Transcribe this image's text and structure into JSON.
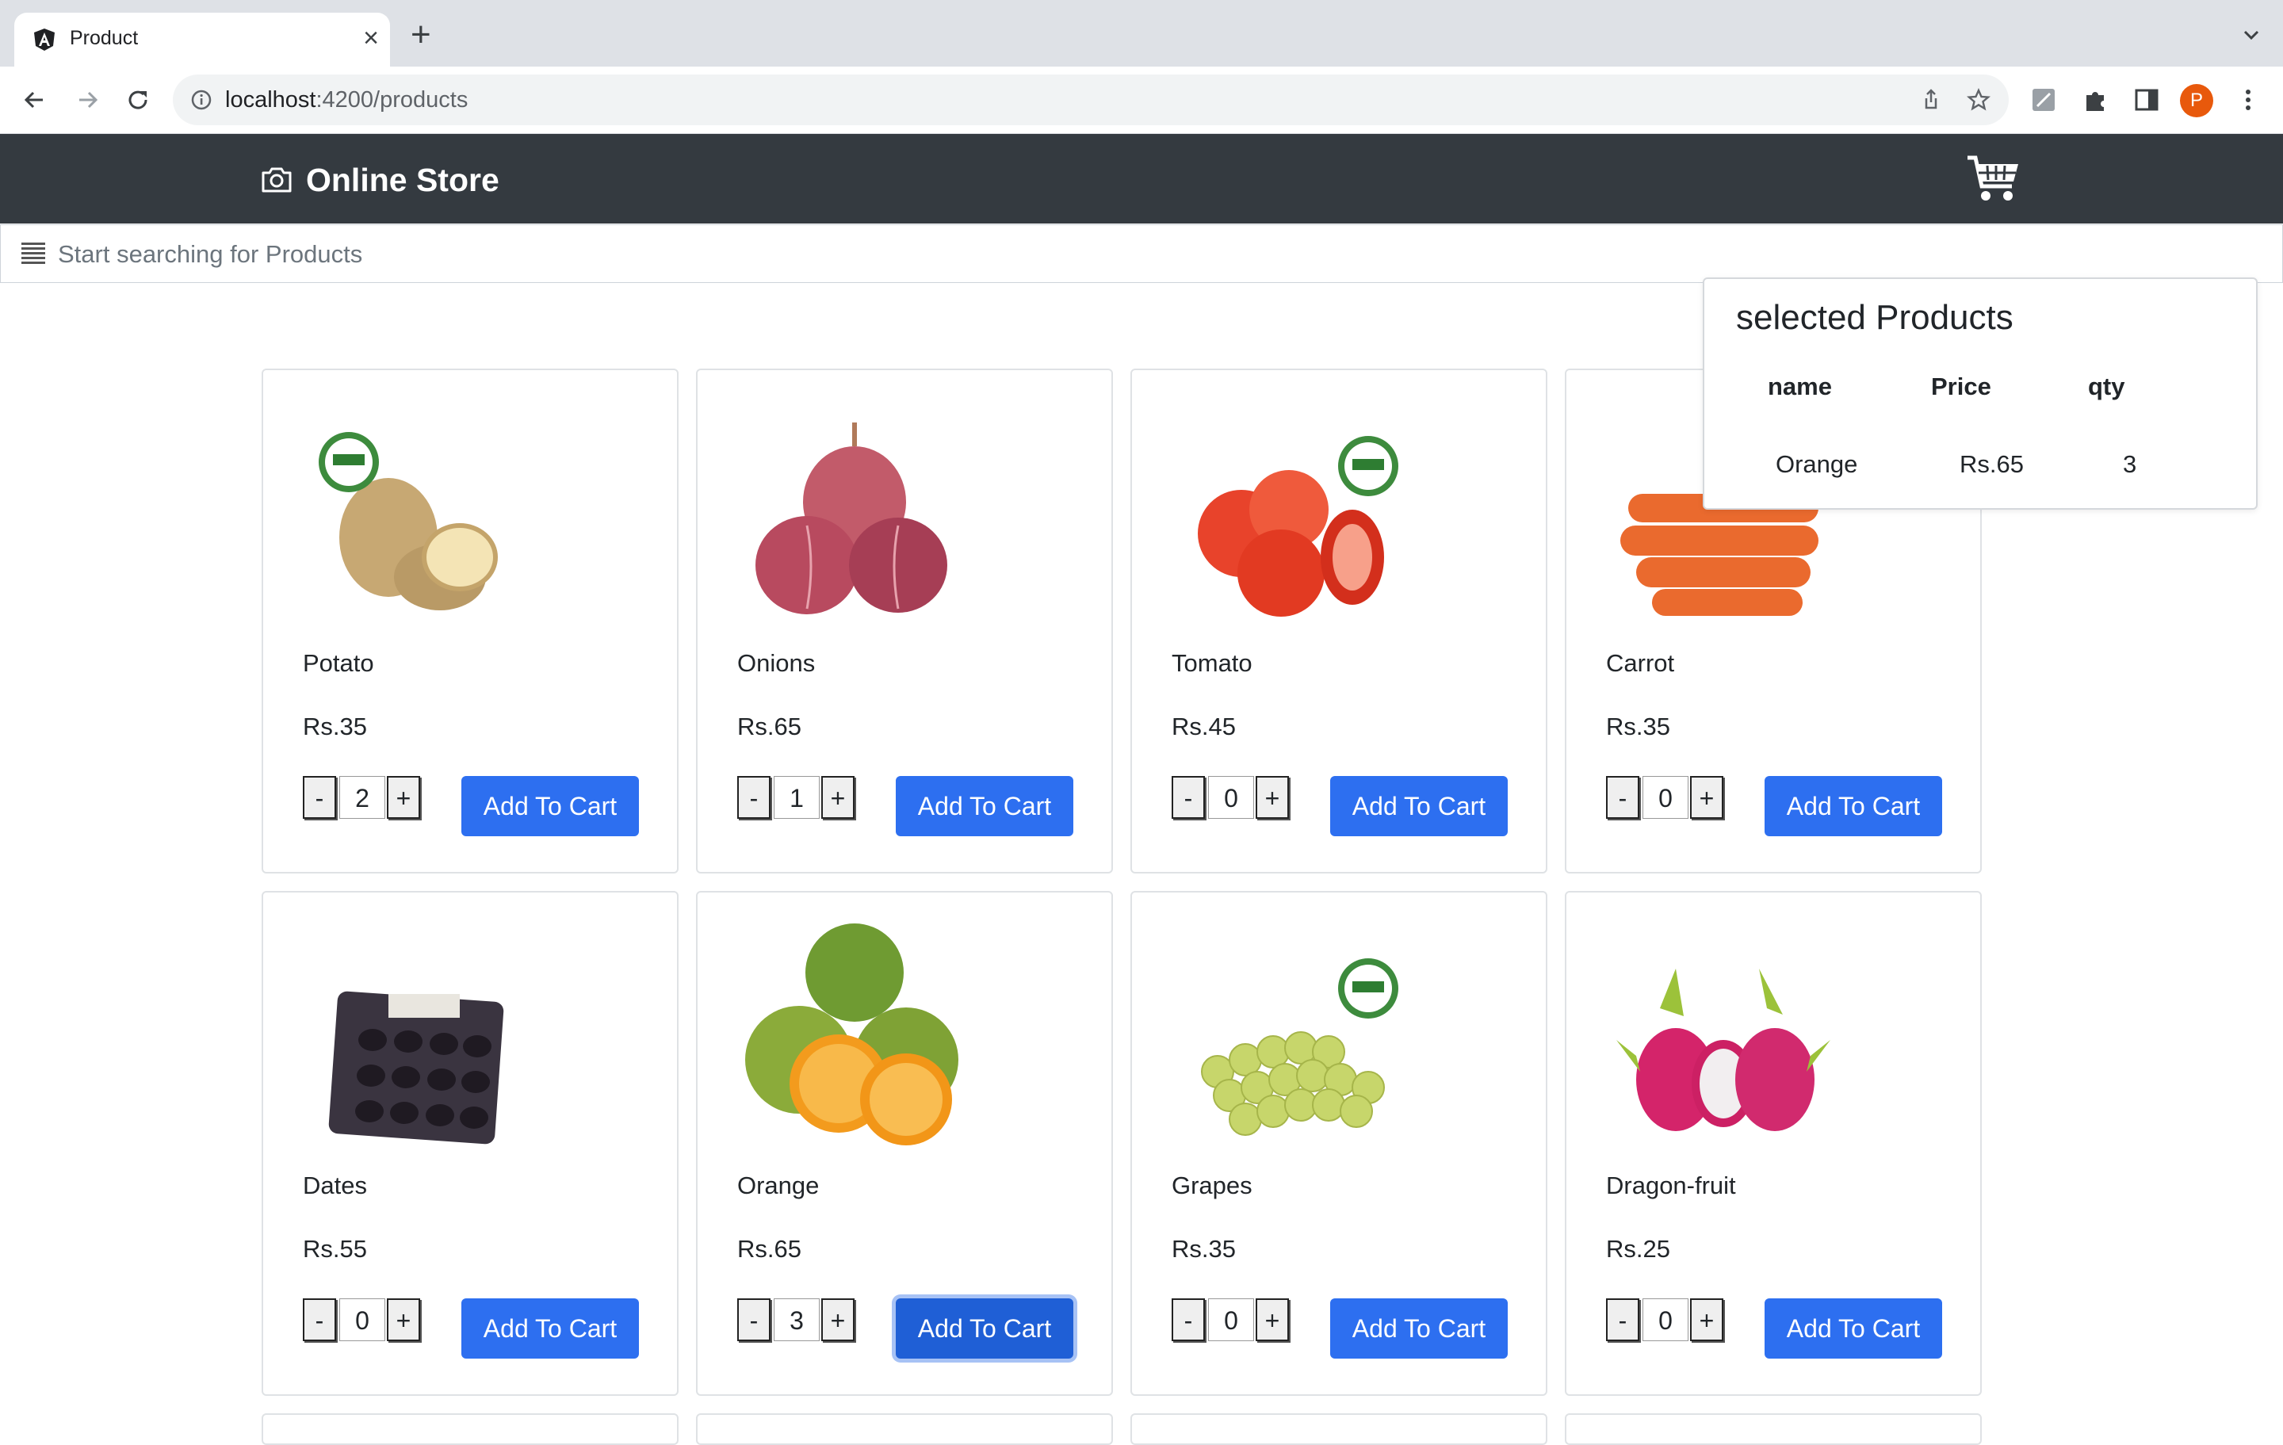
{
  "browser": {
    "tab_title": "Product",
    "url_host": "localhost",
    "url_path": ":4200/products"
  },
  "navbar": {
    "brand": "Online Store"
  },
  "search": {
    "placeholder": "Start searching for Products"
  },
  "products": [
    {
      "name": "Potato",
      "price": "Rs.35",
      "qty": "2",
      "button": "Add To Cart"
    },
    {
      "name": "Onions",
      "price": "Rs.65",
      "qty": "1",
      "button": "Add To Cart"
    },
    {
      "name": "Tomato",
      "price": "Rs.45",
      "qty": "0",
      "button": "Add To Cart"
    },
    {
      "name": "Carrot",
      "price": "Rs.35",
      "qty": "0",
      "button": "Add To Cart"
    },
    {
      "name": "Dates",
      "price": "Rs.55",
      "qty": "0",
      "button": "Add To Cart"
    },
    {
      "name": "Orange",
      "price": "Rs.65",
      "qty": "3",
      "button": "Add To Cart"
    },
    {
      "name": "Grapes",
      "price": "Rs.35",
      "qty": "0",
      "button": "Add To Cart"
    },
    {
      "name": "Dragon-fruit",
      "price": "Rs.25",
      "qty": "0",
      "button": "Add To Cart"
    }
  ],
  "qty_controls": {
    "minus": "-",
    "plus": "+"
  },
  "selected": {
    "title": "selected Products",
    "headers": {
      "name": "name",
      "price": "Price",
      "qty": "qty"
    },
    "rows": [
      {
        "name": "Orange",
        "price": "Rs.65",
        "qty": "3"
      }
    ]
  },
  "avatar_letter": "P",
  "colors": {
    "navbar": "#343a40",
    "primary_button": "#2d6ff0",
    "avatar": "#e8590c"
  }
}
